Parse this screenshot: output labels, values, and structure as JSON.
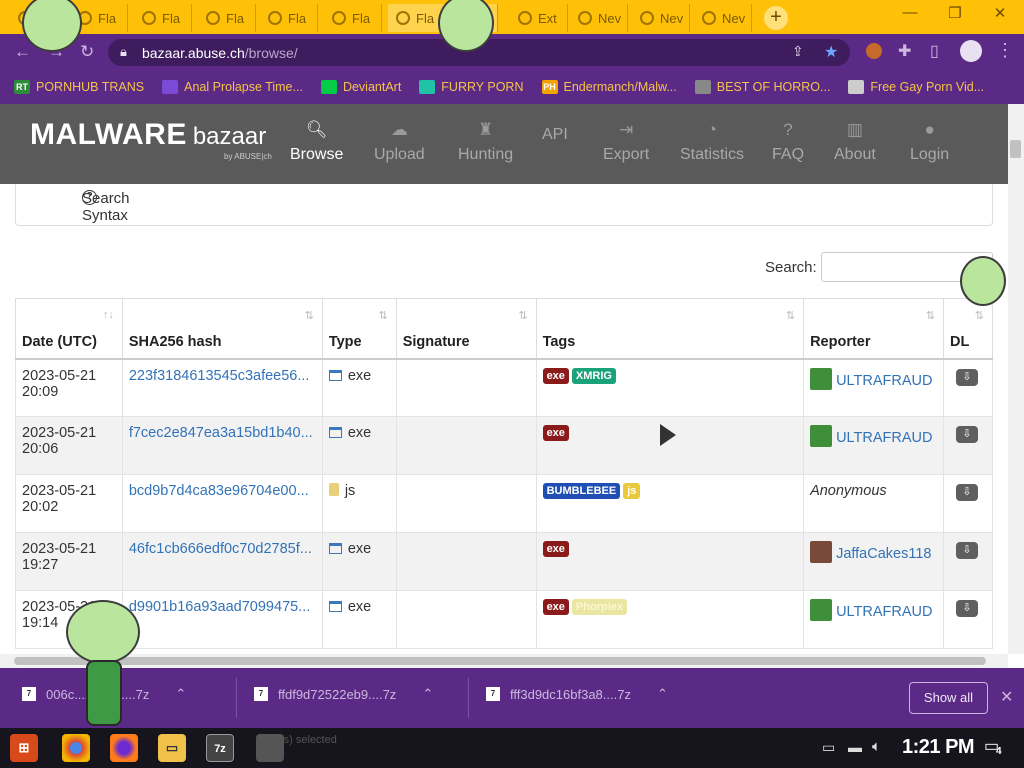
{
  "browser": {
    "tabs": [
      {
        "label": "Fla"
      },
      {
        "label": "Fla"
      },
      {
        "label": "Fla"
      },
      {
        "label": "Fla"
      },
      {
        "label": "Fla"
      },
      {
        "label": "Fla"
      },
      {
        "label": "Fla"
      },
      {
        "label": "Ext"
      },
      {
        "label": "Nev"
      },
      {
        "label": "Nev"
      },
      {
        "label": "Nev"
      }
    ],
    "new_tab": "+",
    "url_host": "bazaar.abuse.ch",
    "url_path": "/browse/",
    "bookmarks": [
      {
        "icon": "RT",
        "label": "PORNHUB TRANS",
        "color": "#2e8b3a"
      },
      {
        "icon": "",
        "label": "Anal Prolapse Time...",
        "color": "#7b4ad6"
      },
      {
        "icon": "",
        "label": "DeviantArt",
        "color": "#05cc47"
      },
      {
        "icon": "",
        "label": "FURRY PORN",
        "color": "#1fc4a6"
      },
      {
        "icon": "PH",
        "label": "Endermanch/Malw...",
        "color": "#f5a300"
      },
      {
        "icon": "",
        "label": "BEST OF HORRO...",
        "color": "#888888"
      },
      {
        "icon": "",
        "label": "Free Gay Porn Vid...",
        "color": "#cccccc"
      }
    ]
  },
  "site": {
    "logo_main": "MALWARE",
    "logo_sub": "bazaar",
    "logo_by": "by ABUSE|ch",
    "nav": [
      {
        "label": "Browse",
        "icon": "search-icon",
        "active": true
      },
      {
        "label": "Upload",
        "icon": "cloud-upload-icon",
        "active": false
      },
      {
        "label": "Hunting",
        "icon": "chess-icon",
        "active": false
      },
      {
        "label": "API",
        "icon": "code-icon",
        "active": false
      },
      {
        "label": "Export",
        "icon": "export-icon",
        "active": false
      },
      {
        "label": "Statistics",
        "icon": "pie-chart-icon",
        "active": false
      },
      {
        "label": "FAQ",
        "icon": "question-icon",
        "active": false
      },
      {
        "label": "About",
        "icon": "building-icon",
        "active": false
      },
      {
        "label": "Login",
        "icon": "user-icon",
        "active": false
      }
    ]
  },
  "search_syntax": "Search Syntax",
  "search_label": "Search:",
  "table": {
    "headers": [
      "Date (UTC)",
      "SHA256 hash",
      "Type",
      "Signature",
      "Tags",
      "Reporter",
      "DL"
    ],
    "rows": [
      {
        "date": "2023-05-21",
        "time": "20:09",
        "hash": "223f3184613545c3afee56...",
        "type": "exe",
        "signature": "",
        "tags": [
          {
            "t": "exe",
            "c": "#8b1a1a"
          },
          {
            "t": "XMRIG",
            "c": "#1aa37a"
          }
        ],
        "reporter": "ULTRAFRAUD",
        "anon": false
      },
      {
        "date": "2023-05-21",
        "time": "20:06",
        "hash": "f7cec2e847ea3a15bd1b40...",
        "type": "exe",
        "signature": "",
        "tags": [
          {
            "t": "exe",
            "c": "#8b1a1a"
          }
        ],
        "reporter": "ULTRAFRAUD",
        "anon": false
      },
      {
        "date": "2023-05-21",
        "time": "20:02",
        "hash": "bcd9b7d4ca83e96704e00...",
        "type": "js",
        "signature": "",
        "tags": [
          {
            "t": "BUMBLEBEE",
            "c": "#1f4fb5"
          },
          {
            "t": "js",
            "c": "#e9c83a"
          }
        ],
        "reporter": "Anonymous",
        "anon": true
      },
      {
        "date": "2023-05-21",
        "time": "19:27",
        "hash": "46fc1cb666edf0c70d2785f...",
        "type": "exe",
        "signature": "",
        "tags": [
          {
            "t": "exe",
            "c": "#8b1a1a"
          }
        ],
        "reporter": "JaffaCakes118",
        "anon": false
      },
      {
        "date": "2023-05-21",
        "time": "19:14",
        "hash": "d9901b16a93aad7099475...",
        "type": "exe",
        "signature": "",
        "tags": [
          {
            "t": "exe",
            "c": "#8b1a1a"
          },
          {
            "t": "Phorpiex",
            "c": "#f3f1a6"
          }
        ],
        "reporter": "ULTRAFRAUD",
        "anon": false
      }
    ]
  },
  "downloads": {
    "items": [
      {
        "name": "006c...251e1....7z"
      },
      {
        "name": "ffdf9d72522eb9....7z"
      },
      {
        "name": "fff3d9dc16bf3a8....7z"
      }
    ],
    "show_all": "Show all"
  },
  "taskbar": {
    "status_ghost": "(s) selected",
    "clock": "1:21 PM",
    "notif_count": "4"
  }
}
